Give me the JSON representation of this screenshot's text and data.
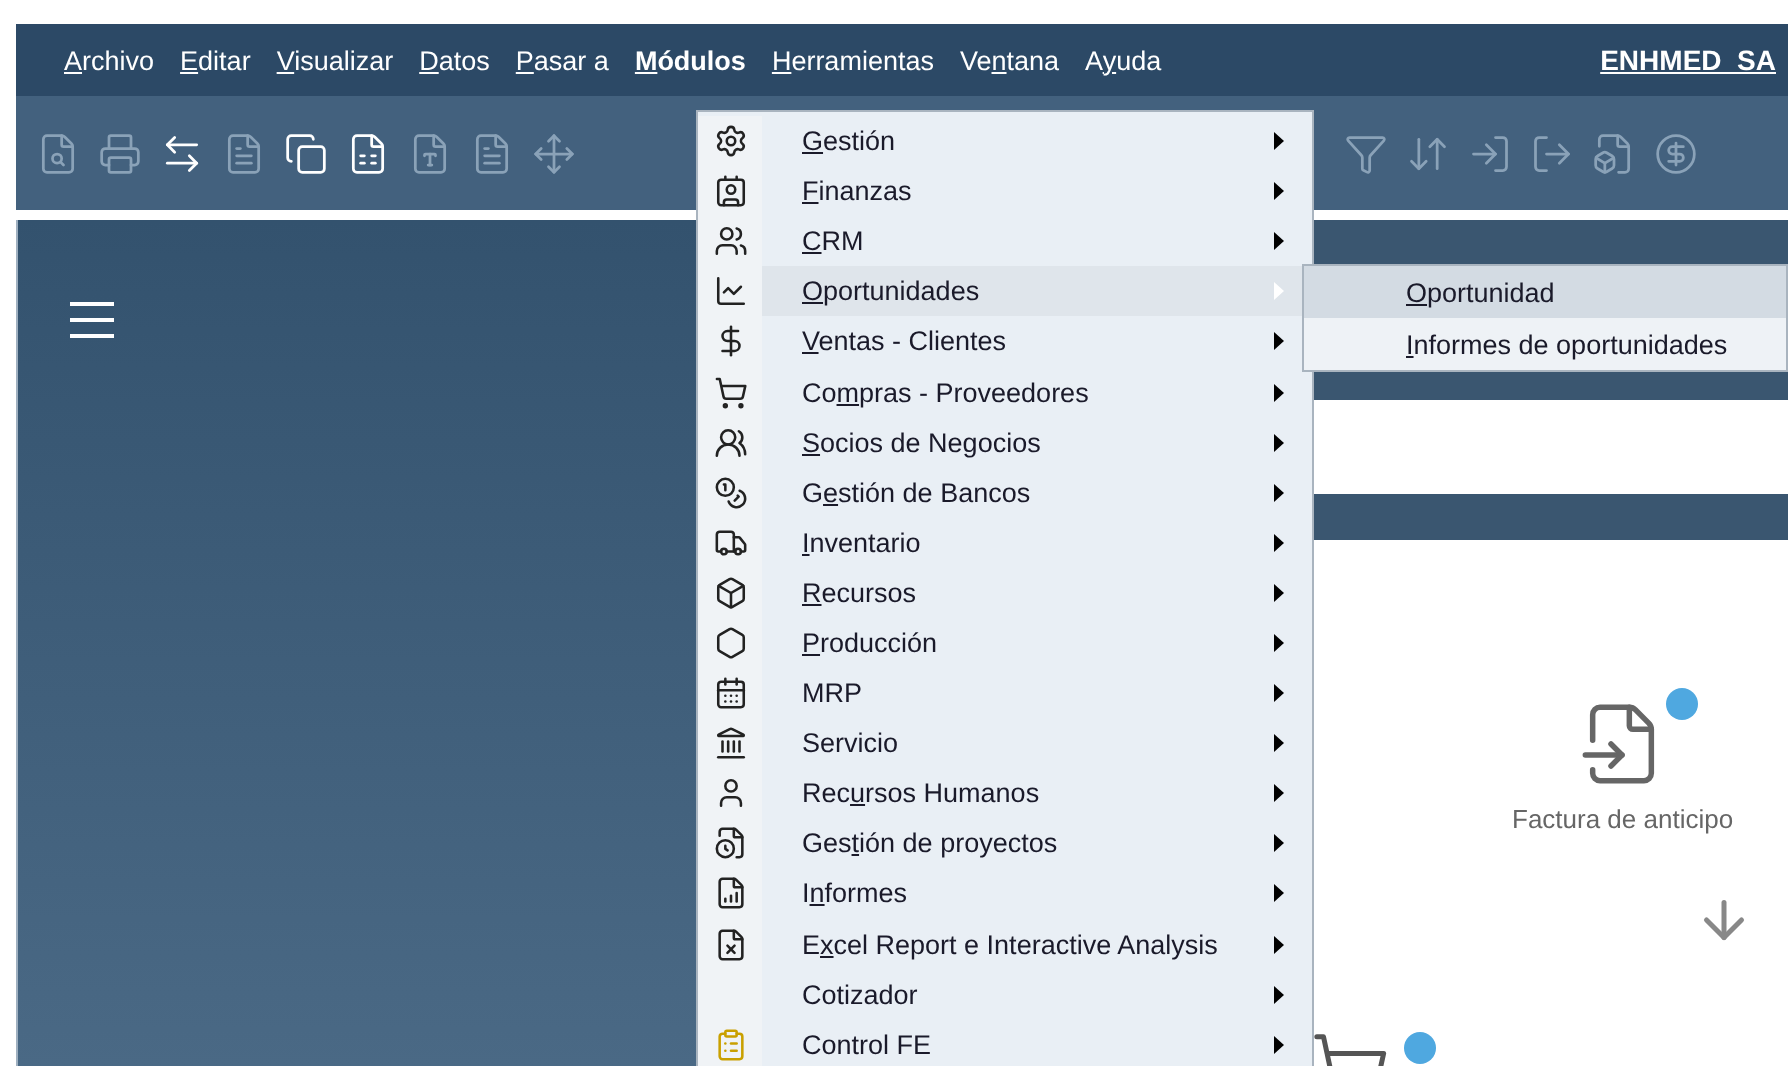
{
  "menu_bar": {
    "items": [
      {
        "label": "Archivo",
        "selected": false
      },
      {
        "label": "Editar",
        "selected": false
      },
      {
        "label": "Visualizar",
        "selected": false
      },
      {
        "label": "Datos",
        "selected": false
      },
      {
        "label": "Pasar a",
        "selected": false
      },
      {
        "label": "Módulos",
        "selected": true
      },
      {
        "label": "Herramientas",
        "selected": false
      },
      {
        "label": "Ventana",
        "selected": false
      },
      {
        "label": "Ayuda",
        "selected": false
      }
    ],
    "company": "ENHMED_SA"
  },
  "modules_menu": {
    "items": [
      {
        "label": "Gestión",
        "selected": false
      },
      {
        "label": "Finanzas",
        "selected": false
      },
      {
        "label": "CRM",
        "selected": false
      },
      {
        "label": "Oportunidades",
        "selected": true
      },
      {
        "label": "Ventas - Clientes",
        "selected": false
      },
      {
        "label": "Compras - Proveedores",
        "selected": false
      },
      {
        "label": "Socios de Negocios",
        "selected": false
      },
      {
        "label": "Gestión de Bancos",
        "selected": false
      },
      {
        "label": "Inventario",
        "selected": false
      },
      {
        "label": "Recursos",
        "selected": false
      },
      {
        "label": "Producción",
        "selected": false
      },
      {
        "label": "MRP",
        "selected": false
      },
      {
        "label": "Servicio",
        "selected": false
      },
      {
        "label": "Recursos Humanos",
        "selected": false
      },
      {
        "label": "Gestión de proyectos",
        "selected": false
      },
      {
        "label": "Informes",
        "selected": false
      },
      {
        "label": "Excel Report e Interactive Analysis",
        "selected": false
      },
      {
        "label": "Cotizador",
        "selected": false
      },
      {
        "label": "Control FE",
        "selected": false
      }
    ]
  },
  "submenu": {
    "items": [
      {
        "label": "Oportunidad",
        "selected": true
      },
      {
        "label": "Informes de oportunidades",
        "selected": false
      }
    ]
  },
  "flow": {
    "caption": "Factura de anticipo"
  }
}
